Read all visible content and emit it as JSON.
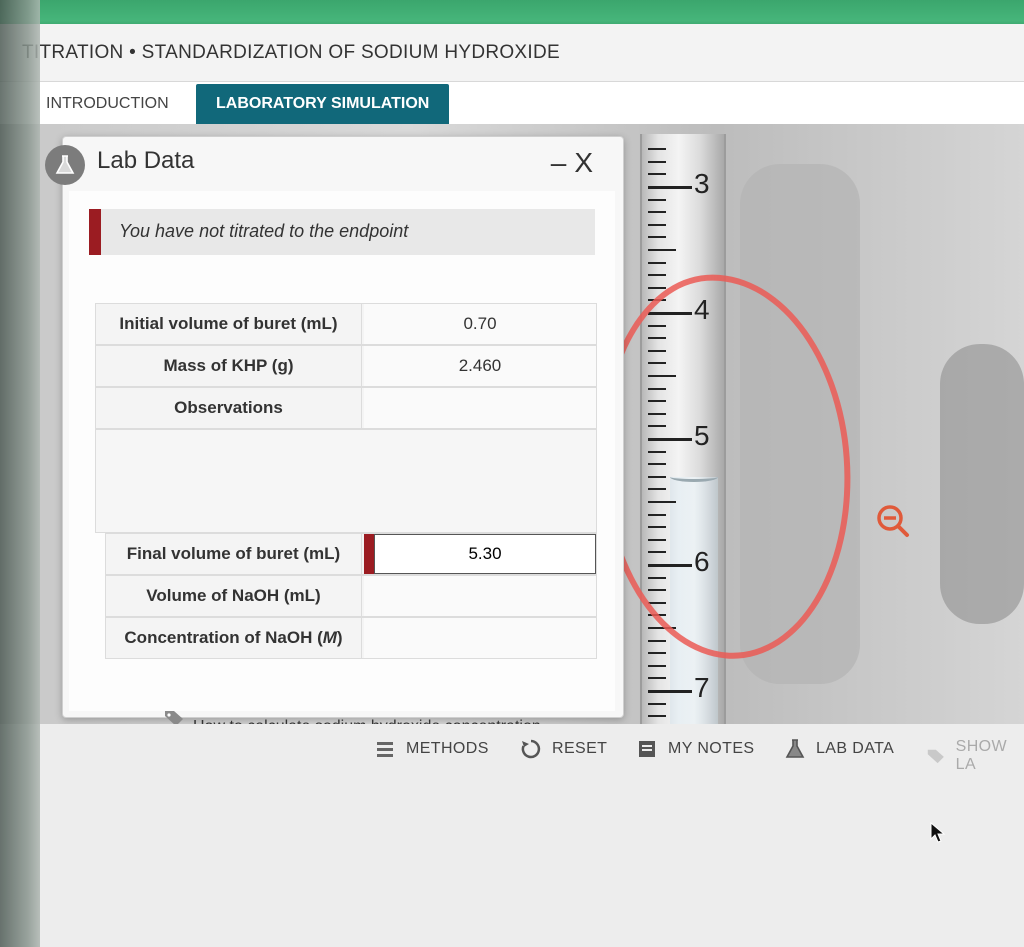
{
  "app": {
    "title": "TITRATION • STANDARDIZATION OF SODIUM HYDROXIDE"
  },
  "tabs": [
    {
      "label": "INTRODUCTION",
      "active": false
    },
    {
      "label": "LABORATORY SIMULATION",
      "active": true
    }
  ],
  "dialog": {
    "title": "Lab Data",
    "minimize": "–",
    "close": "X",
    "alert": "You have not titrated to the endpoint",
    "rows": {
      "initial_volume": {
        "label": "Initial volume of buret (mL)",
        "value": "0.70"
      },
      "mass_khp": {
        "label": "Mass of KHP (g)",
        "value": "2.460"
      },
      "observations": {
        "label": "Observations",
        "value": ""
      },
      "final_volume": {
        "label": "Final volume of buret (mL)",
        "value": "5.30"
      },
      "volume_naoh": {
        "label": "Volume of NaOH (mL)",
        "value": ""
      },
      "concentration_label": "Concentration of NaOH (",
      "concentration_unit": "M",
      "concentration_close": ")",
      "concentration_value": ""
    },
    "help_link": "How to calculate sodium hydroxide concentration"
  },
  "buret": {
    "labels": [
      "3",
      "4",
      "5",
      "6",
      "7"
    ],
    "reading_ml": 5.3
  },
  "toolbar": {
    "methods": "METHODS",
    "reset": "RESET",
    "my_notes": "MY NOTES",
    "lab_data": "LAB DATA",
    "show_labels": "SHOW LA"
  },
  "colors": {
    "accent_tab": "#11687a",
    "alert_red": "#9b1c22",
    "annotation_circle": "#eb5a55",
    "zoom_icon": "#e05a3a"
  },
  "icons": [
    "flask-icon",
    "list-icon",
    "reset-icon",
    "notes-icon",
    "tag-icon",
    "zoom-out-icon",
    "cursor-icon"
  ]
}
